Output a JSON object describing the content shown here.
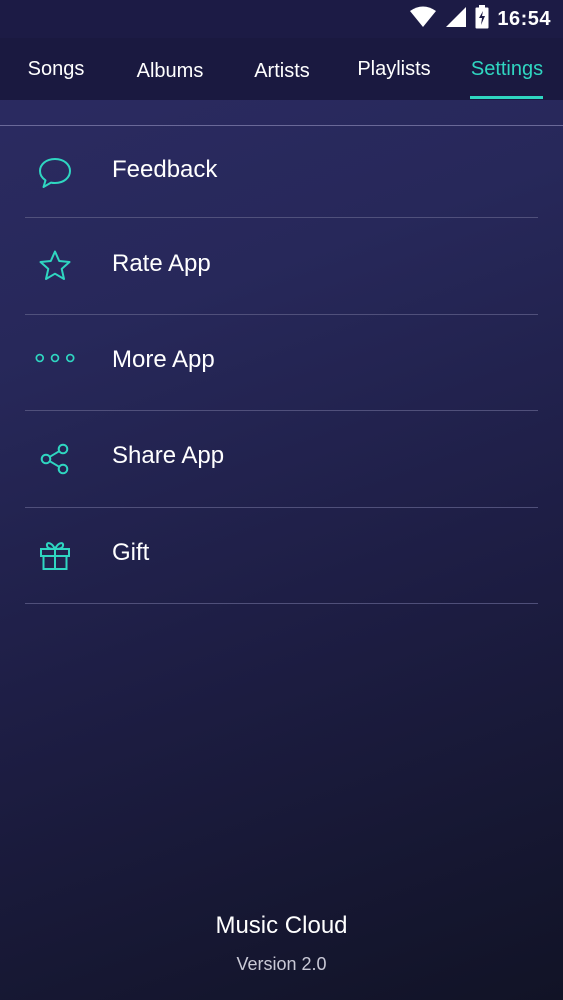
{
  "status_bar": {
    "time": "16:54",
    "icons": [
      "wifi-icon",
      "signal-icon",
      "battery-charging-icon"
    ]
  },
  "tabs": [
    {
      "label": "Songs",
      "active": false
    },
    {
      "label": "Albums",
      "active": false
    },
    {
      "label": "Artists",
      "active": false
    },
    {
      "label": "Playlists",
      "active": false
    },
    {
      "label": "Settings",
      "active": true
    }
  ],
  "menu": [
    {
      "label": "Feedback",
      "icon": "chat-bubble-icon"
    },
    {
      "label": "Rate App",
      "icon": "star-icon"
    },
    {
      "label": "More App",
      "icon": "more-dots-icon"
    },
    {
      "label": "Share App",
      "icon": "share-icon"
    },
    {
      "label": "Gift",
      "icon": "gift-icon"
    }
  ],
  "footer": {
    "app_name": "Music Cloud",
    "version": "Version 2.0"
  },
  "colors": {
    "accent": "#2fd6c1",
    "status_bar_bg": "#1c1b45",
    "tab_bar_bg": "#1a1940",
    "background_top": "#2c2b63",
    "background_bottom": "#111326",
    "text": "#ffffff"
  }
}
